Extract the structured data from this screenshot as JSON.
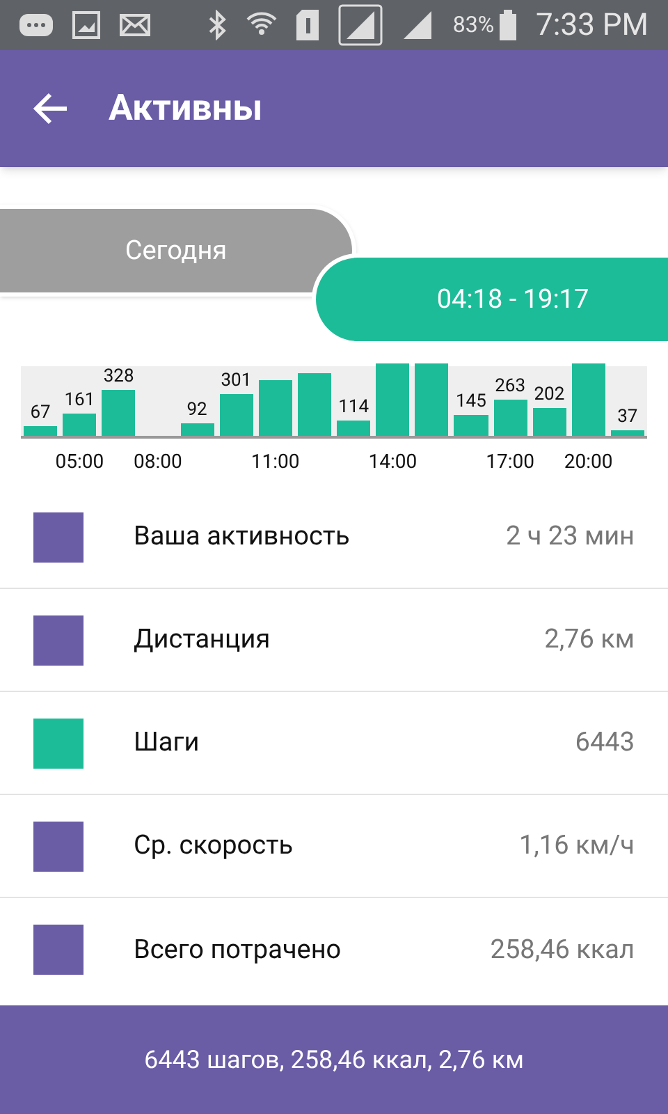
{
  "status_bar": {
    "battery": "83%",
    "time": "7:33 PM"
  },
  "app_bar": {
    "title": "Активны"
  },
  "period": {
    "day": "Сегодня",
    "range": "04:18 - 19:17"
  },
  "step_bars": [
    {
      "kind": "bar",
      "value": "67"
    },
    {
      "kind": "bar",
      "value": "161",
      "axis_label": "05:00"
    },
    {
      "kind": "bar",
      "value": "328"
    },
    {
      "kind": "gap",
      "axis_label": "08:00"
    },
    {
      "kind": "bar",
      "value": "92"
    },
    {
      "kind": "bar",
      "value": "301"
    },
    {
      "kind": "bar",
      "axis_label": "11:00"
    },
    {
      "kind": "bar"
    },
    {
      "kind": "bar",
      "value": "114"
    },
    {
      "kind": "bar",
      "axis_label": "14:00"
    },
    {
      "kind": "bar"
    },
    {
      "kind": "bar",
      "value": "145"
    },
    {
      "kind": "bar",
      "value": "263",
      "axis_label": "17:00"
    },
    {
      "kind": "bar",
      "value": "202"
    },
    {
      "kind": "bar",
      "axis_label": "20:00"
    },
    {
      "kind": "bar",
      "value": "37"
    }
  ],
  "stats": [
    {
      "label": "Ваша активность",
      "value": "2 ч 23 мин",
      "color": "#6a5ca5"
    },
    {
      "label": "Дистанция",
      "value": "2,76 км",
      "color": "#6a5ca5"
    },
    {
      "label": "Шаги",
      "value": "6443",
      "color": "#1dbc98"
    },
    {
      "label": "Ср. скорость",
      "value": "1,16 км/ч",
      "color": "#6a5ca5"
    },
    {
      "label": "Всего потрачено",
      "value": "258,46 ккал",
      "color": "#6a5ca5"
    }
  ],
  "footer": "6443 шагов, 258,46 ккал, 2,76 км"
}
